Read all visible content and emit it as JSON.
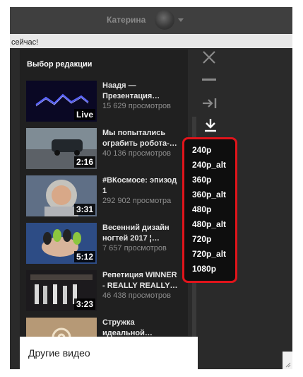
{
  "header": {
    "username": "Катерина"
  },
  "status_text": "сейчас!",
  "playlist": {
    "title": "Выбор редакции",
    "videos": [
      {
        "title": "Наадя — Презентация…",
        "views": "15 629 просмотров",
        "duration": "Live"
      },
      {
        "title": "Мы попытались ограбить робота-…",
        "views": "40 136 просмотров",
        "duration": "2:16"
      },
      {
        "title": "#ВКосмосе: эпизод 1",
        "views": "292 902 просмотра",
        "duration": "3:31"
      },
      {
        "title": "Весенний дизайн ногтей 2017 ¦…",
        "views": "7 657 просмотров",
        "duration": "5:12"
      },
      {
        "title": "Репетиция WINNER - REALLY REALLY…",
        "views": "46 438 просмотров",
        "duration": "3:23"
      },
      {
        "title": "Стружка идеальной…",
        "views": "",
        "duration": ""
      }
    ]
  },
  "other_videos_label": "Другие видео",
  "quality_options": [
    "240p",
    "240p_alt",
    "360p",
    "360p_alt",
    "480p",
    "480p_alt",
    "720p",
    "720p_alt",
    "1080p"
  ],
  "colors": {
    "highlight": "#e0141b",
    "panel": "#202020",
    "icon": "#8a8a8a"
  },
  "icons": [
    "close-icon",
    "minimize-icon",
    "open-in-tab-icon",
    "download-icon",
    "resize-icon"
  ]
}
